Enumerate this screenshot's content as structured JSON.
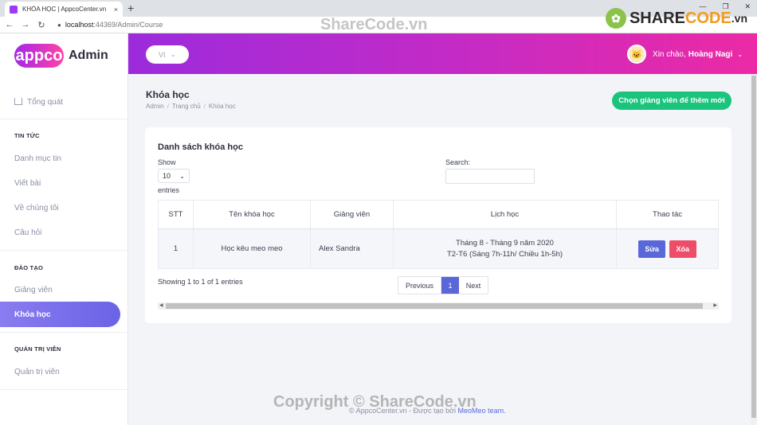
{
  "browser": {
    "tab_title": "KHÓA HỌC | AppcoCenter.vn",
    "tab_close": "×",
    "new_tab": "+",
    "url_host": "localhost",
    "url_path": ":44369/Admin/Course",
    "win_min": "—",
    "win_max": "❐",
    "win_close": "✕"
  },
  "watermark": {
    "logo_share": "SHARE",
    "logo_code": "CODE",
    "logo_vn": ".vn",
    "top_text": "ShareCode.vn",
    "bottom_text": "Copyright © ShareCode.vn"
  },
  "sidebar": {
    "brand_logo": "appco",
    "brand_admin": "Admin",
    "overview": "Tổng quát",
    "sections": {
      "news": "TIN TỨC",
      "training": "ĐÀO TẠO",
      "admin": "QUẢN TRỊ VIÊN"
    },
    "items": {
      "categories": "Danh mục tin",
      "posts": "Viết bài",
      "about": "Về chúng tôi",
      "faq": "Câu hỏi",
      "teachers": "Giảng viên",
      "courses": "Khóa học",
      "admins": "Quản trị viên"
    }
  },
  "header": {
    "lang": "VI",
    "greeting": "Xin chào,",
    "user_name": "Hoàng Nagi"
  },
  "page": {
    "title": "Khóa học",
    "breadcrumb": [
      "Admin",
      "Trang chủ",
      "Khóa học"
    ],
    "add_button": "Chọn giảng viên để thêm mới"
  },
  "card": {
    "title": "Danh sách khóa học",
    "show_label": "Show",
    "show_value": "10",
    "entries_label": "entries",
    "search_label": "Search:",
    "columns": [
      "STT",
      "Tên khóa học",
      "Giảng viên",
      "Lịch học",
      "Thao tác"
    ],
    "rows": [
      {
        "stt": "1",
        "name": "Học kêu meo meo",
        "teacher": "Alex Sandra",
        "schedule_line1": "Tháng 8 - Tháng 9 năm 2020",
        "schedule_line2": "T2-T6 (Sáng 7h-11h/ Chiều 1h-5h)",
        "edit": "Sửa",
        "delete": "Xóa"
      }
    ],
    "info": "Showing 1 to 1 of 1 entries",
    "pager": {
      "prev": "Previous",
      "current": "1",
      "next": "Next"
    }
  },
  "footer": {
    "text": "© AppcoCenter.vn - Được tạo bởi",
    "team": "MeoMeo team."
  },
  "colors": {
    "accent": "#5a67d8",
    "success": "#1bc47d",
    "danger": "#ee4d6a",
    "header_start": "#9c2bdc",
    "header_end": "#ec2aa5"
  }
}
